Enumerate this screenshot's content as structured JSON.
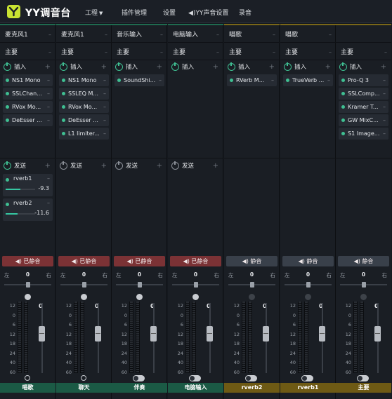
{
  "app": {
    "title": "YY调音台"
  },
  "menu": {
    "project": "工程",
    "plugins": "插件管理",
    "settings": "设置",
    "audio": "YY声音设置",
    "record": "录音"
  },
  "icons": {
    "logo": "yy-logo-icon",
    "caret": "chevron-down-icon",
    "power": "power-icon",
    "plus": "plus-icon",
    "minus": "minus-icon",
    "speaker": "speaker-icon"
  },
  "colors": {
    "accent": "#c9e332",
    "active_green": "#3fbf92",
    "muted_red": "#7b3235",
    "label_green": "#1b5a45",
    "label_gold": "#6e5a14"
  },
  "labels": {
    "inserts": "插入",
    "sends": "发送",
    "left": "左",
    "right": "右"
  },
  "db_scale": [
    "12",
    "0",
    "6",
    "12",
    "18",
    "24",
    "40",
    "60"
  ],
  "channels": [
    {
      "name": "麦克风1",
      "route": "主要",
      "inserts": [
        "NS1 Mono",
        "SSLChan...",
        "RVox Mo...",
        "DeEsser ..."
      ],
      "sends": [
        {
          "name": "rverb1",
          "db": "-9.3",
          "level": 0.5
        },
        {
          "name": "rverb2",
          "db": "-11.6",
          "level": 0.4
        }
      ],
      "mute": "已静音",
      "muted": true,
      "pan": "0",
      "gain": "0",
      "bottom_label": "唱歌",
      "label_color": "green",
      "control": "ring"
    },
    {
      "name": "麦克风1",
      "route": "主要",
      "inserts": [
        "NS1 Mono",
        "SSLEQ M...",
        "RVox Mo...",
        "DeEsser ...",
        "L1 limiter..."
      ],
      "sends": [],
      "mute": "已静音",
      "muted": true,
      "pan": "0",
      "gain": "0",
      "bottom_label": "聊天",
      "label_color": "green",
      "control": "ring"
    },
    {
      "name": "音乐输入",
      "route": "主要",
      "inserts": [
        "SoundShi..."
      ],
      "sends": [],
      "mute": "已静音",
      "muted": true,
      "pan": "0",
      "gain": "0",
      "bottom_label": "伴奏",
      "label_color": "green",
      "control": "toggle"
    },
    {
      "name": "电脑输入",
      "route": "主要",
      "inserts": [],
      "sends": [],
      "mute": "已静音",
      "muted": true,
      "pan": "0",
      "gain": "0",
      "bottom_label": "电脑输入",
      "label_color": "green",
      "control": "toggle"
    },
    {
      "name": "唱歌",
      "route": "主要",
      "inserts": [
        "RVerb M..."
      ],
      "sends": null,
      "mute": "静音",
      "muted": false,
      "pan": "0",
      "gain": "0",
      "bottom_label": "rverb2",
      "label_color": "gold",
      "control": "toggle"
    },
    {
      "name": "唱歌",
      "route": "主要",
      "inserts": [
        "TrueVerb ..."
      ],
      "sends": null,
      "mute": "静音",
      "muted": false,
      "pan": "0",
      "gain": "0",
      "bottom_label": "rverb1",
      "label_color": "gold",
      "control": "toggle"
    },
    {
      "name": "",
      "route": "主要",
      "inserts": [
        "Pro-Q 3",
        "SSLComp...",
        "Kramer T...",
        "GW MixC...",
        "S1 Image..."
      ],
      "sends": null,
      "mute": "静音",
      "muted": false,
      "pan": "0",
      "gain": "0",
      "bottom_label": "主要",
      "label_color": "gold",
      "control": "toggle"
    }
  ]
}
